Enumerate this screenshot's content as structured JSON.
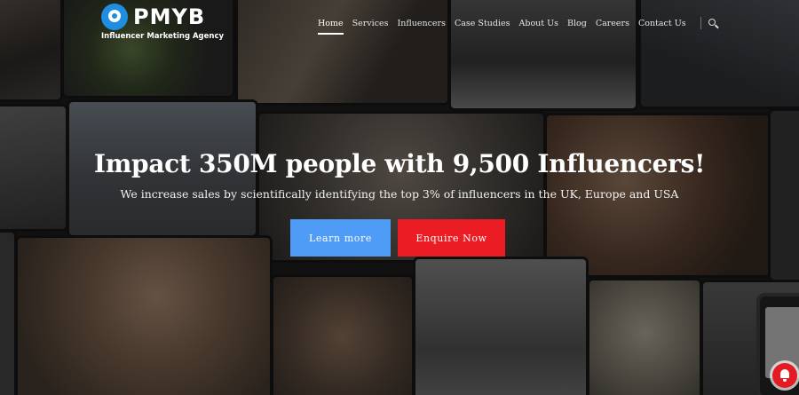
{
  "brand": {
    "name": "PMYB",
    "tagline": "Influencer Marketing Agency",
    "accent": "#1f8de0"
  },
  "nav": {
    "items": [
      "Home",
      "Services",
      "Influencers",
      "Case Studies",
      "About Us",
      "Blog",
      "Careers",
      "Contact Us"
    ],
    "active": "Home",
    "search_icon": "search-icon"
  },
  "hero": {
    "title": "Impact 350M people with 9,500 Influencers!",
    "subtitle": "We increase sales by scientifically identifying the top 3% of influencers in the UK, Europe and USA",
    "learn_button": "Learn more",
    "enquire_button": "Enquire Now",
    "learn_color": "#4f9cf7",
    "enquire_color": "#ec1c24"
  },
  "notification": {
    "icon": "bell-icon",
    "color": "#e31b23"
  }
}
